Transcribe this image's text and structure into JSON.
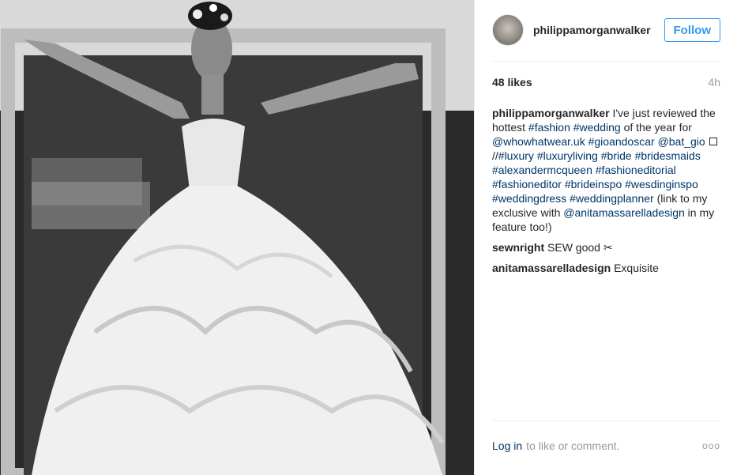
{
  "post": {
    "username": "philippamorganwalker",
    "follow_label": "Follow",
    "likes": "48 likes",
    "time_ago": "4h",
    "caption_author": "philippamorganwalker",
    "caption": {
      "t1": " I've just reviewed the hottest ",
      "l1": "#fashion",
      "s1": " ",
      "l2": "#wedding",
      "t2": " of the year for ",
      "l3": "@whowhatwear.uk",
      "s2": " ",
      "l4": "#gioandoscar",
      "s3": " ",
      "l5": "@bat_gio",
      "t3": " //",
      "l6": "#luxury",
      "s4": " ",
      "l7": "#luxuryliving",
      "s5": " ",
      "l8": "#bride",
      "s6": " ",
      "l9": "#bridesmaids",
      "s7": " ",
      "l10": "#alexandermcqueen",
      "s8": " ",
      "l11": "#fashioneditorial",
      "s9": " ",
      "l12": "#fashioneditor",
      "s10": " ",
      "l13": "#brideinspo",
      "s11": " ",
      "l14": "#wesdinginspo",
      "s12": " ",
      "l15": "#weddingdress",
      "s13": " ",
      "l16": "#weddingplanner",
      "t4": " (link to my exclusive with ",
      "l17": "@anitamassarelladesign",
      "t5": " in my feature too!)"
    },
    "comments": [
      {
        "author": "sewnright",
        "text": " SEW good ✂"
      },
      {
        "author": "anitamassarelladesign",
        "text": " Exquisite"
      }
    ],
    "login_link": "Log in",
    "login_suffix": "to like or comment.",
    "more_icon": "ooo"
  },
  "colors": {
    "link": "#003569",
    "accent": "#3897f0",
    "muted": "#999999"
  },
  "icons": [
    "more-options-icon"
  ]
}
